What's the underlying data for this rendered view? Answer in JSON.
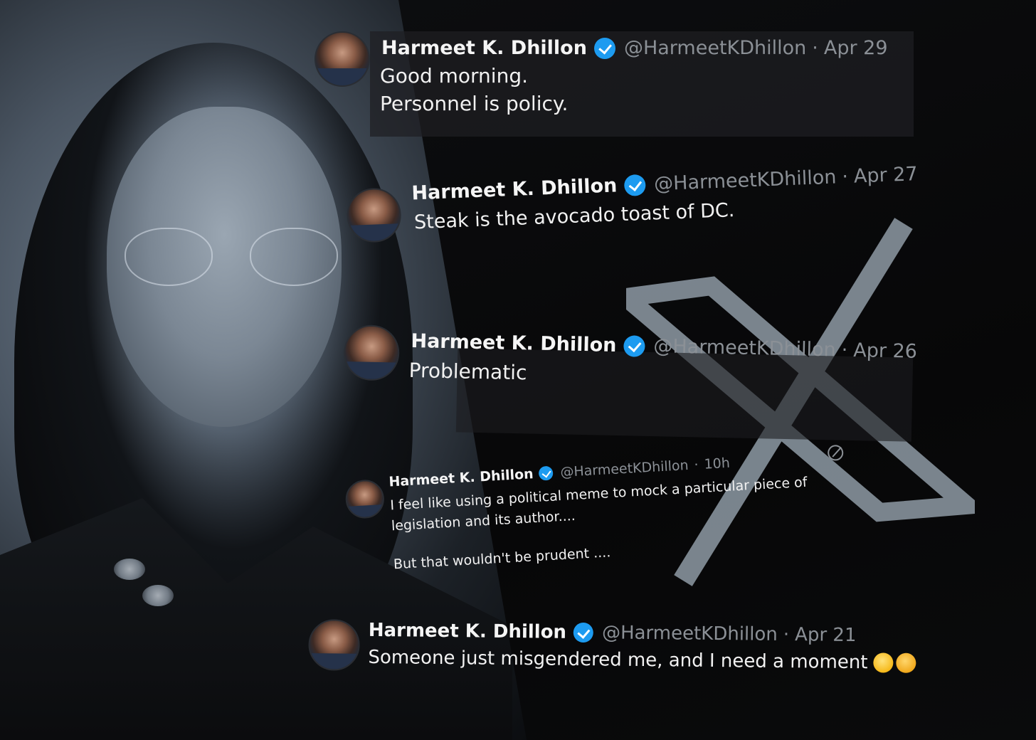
{
  "colors": {
    "background": "#050505",
    "tweet_text": "#f1f1f1",
    "handle_gray": "#8b9096",
    "verified_blue": "#1d9bf0",
    "x_logo_gray": "#8e9aa5"
  },
  "icons": {
    "verified": "verified-badge-icon",
    "x_logo": "x-logo-icon",
    "grok": "grok-icon"
  },
  "tweets": [
    {
      "name": "Harmeet K. Dhillon",
      "handle": "@HarmeetKDhillon",
      "sep": "·",
      "date": "Apr 29",
      "lines": [
        "Good morning.",
        "Personnel is policy."
      ]
    },
    {
      "name": "Harmeet K. Dhillon",
      "handle": "@HarmeetKDhillon",
      "sep": "·",
      "date": "Apr 27",
      "lines": [
        "Steak is the avocado toast of DC."
      ]
    },
    {
      "name": "Harmeet K. Dhillon",
      "handle": "@HarmeetKDhillon",
      "sep": "·",
      "date": "Apr 26",
      "lines": [
        "Problematic"
      ]
    },
    {
      "name": "Harmeet K. Dhillon",
      "handle": "@HarmeetKDhillon",
      "sep": "·",
      "date": "10h",
      "lines": [
        "I feel like using a political meme to mock a particular piece of legislation and its author....",
        "But that wouldn't be prudent ...."
      ]
    },
    {
      "name": "Harmeet K. Dhillon",
      "handle": "@HarmeetKDhillon",
      "sep": "·",
      "date": "Apr 21",
      "lines": [
        "Someone just misgendered me, and I need a moment"
      ]
    }
  ]
}
